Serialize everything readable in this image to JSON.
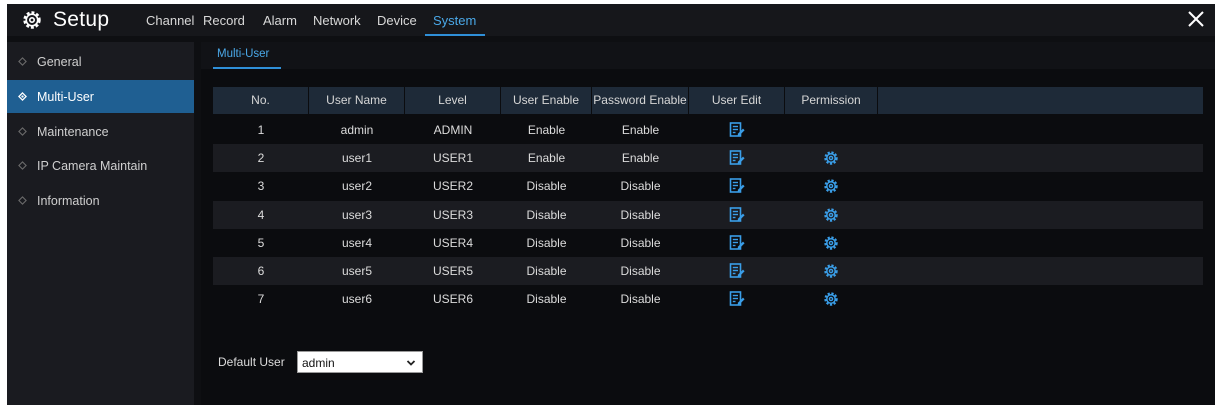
{
  "header": {
    "title": "Setup",
    "tabs": [
      {
        "label": "Channel"
      },
      {
        "label": "Record"
      },
      {
        "label": "Alarm"
      },
      {
        "label": "Network"
      },
      {
        "label": "Device"
      },
      {
        "label": "System",
        "active": true
      }
    ]
  },
  "sidebar": {
    "items": [
      {
        "label": "General"
      },
      {
        "label": "Multi-User",
        "active": true
      },
      {
        "label": "Maintenance"
      },
      {
        "label": "IP Camera Maintain"
      },
      {
        "label": "Information"
      }
    ]
  },
  "main": {
    "subtab": "Multi-User",
    "table": {
      "columns": [
        "No.",
        "User Name",
        "Level",
        "User Enable",
        "Password Enable",
        "User Edit",
        "Permission"
      ],
      "rows": [
        {
          "no": "1",
          "user": "admin",
          "level": "ADMIN",
          "user_enable": "Enable",
          "password_enable": "Enable",
          "edit_icon": "edit-icon",
          "permission_icon": ""
        },
        {
          "no": "2",
          "user": "user1",
          "level": "USER1",
          "user_enable": "Enable",
          "password_enable": "Enable",
          "edit_icon": "edit-icon",
          "permission_icon": "gear-icon"
        },
        {
          "no": "3",
          "user": "user2",
          "level": "USER2",
          "user_enable": "Disable",
          "password_enable": "Disable",
          "edit_icon": "edit-icon",
          "permission_icon": "gear-icon"
        },
        {
          "no": "4",
          "user": "user3",
          "level": "USER3",
          "user_enable": "Disable",
          "password_enable": "Disable",
          "edit_icon": "edit-icon",
          "permission_icon": "gear-icon"
        },
        {
          "no": "5",
          "user": "user4",
          "level": "USER4",
          "user_enable": "Disable",
          "password_enable": "Disable",
          "edit_icon": "edit-icon",
          "permission_icon": "gear-icon"
        },
        {
          "no": "6",
          "user": "user5",
          "level": "USER5",
          "user_enable": "Disable",
          "password_enable": "Disable",
          "edit_icon": "edit-icon",
          "permission_icon": "gear-icon"
        },
        {
          "no": "7",
          "user": "user6",
          "level": "USER6",
          "user_enable": "Disable",
          "password_enable": "Disable",
          "edit_icon": "edit-icon",
          "permission_icon": "gear-icon"
        }
      ]
    },
    "default_user": {
      "label": "Default User",
      "value": "admin"
    }
  },
  "colors": {
    "accent": "#2f8fd8",
    "active_sidebar": "#1f5f92",
    "icon_blue": "#3a9ee8"
  }
}
